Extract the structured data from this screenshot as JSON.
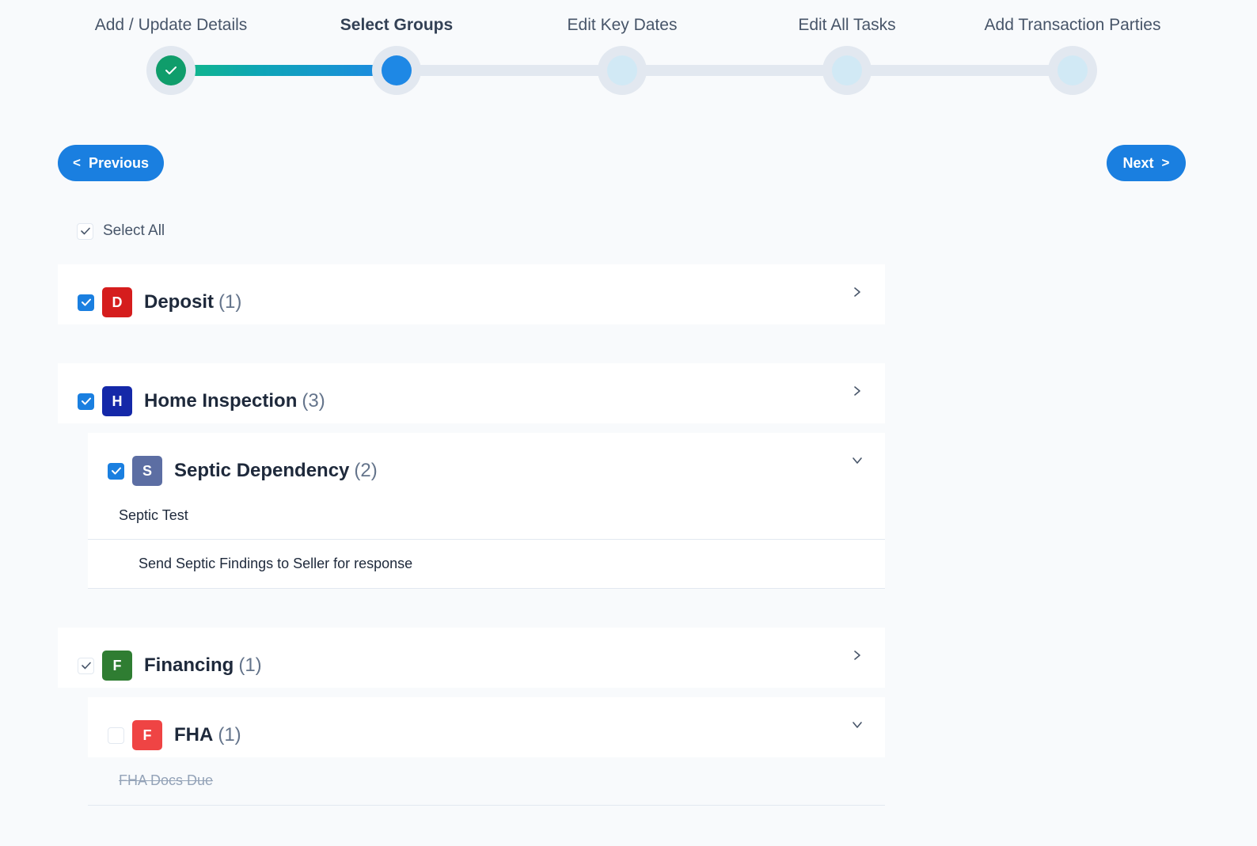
{
  "stepper": {
    "steps": [
      {
        "label": "Add / Update Details",
        "state": "done"
      },
      {
        "label": "Select Groups",
        "state": "current"
      },
      {
        "label": "Edit Key Dates",
        "state": "pending"
      },
      {
        "label": "Edit All Tasks",
        "state": "pending"
      },
      {
        "label": "Add Transaction Parties",
        "state": "pending"
      }
    ]
  },
  "nav": {
    "previous_label": "Previous",
    "next_label": "Next"
  },
  "select_all": {
    "label": "Select All",
    "checked": true
  },
  "groups": {
    "deposit": {
      "letter": "D",
      "name": "Deposit",
      "count": "(1)",
      "color": "#d51d1d",
      "checked": true
    },
    "home_inspection": {
      "letter": "H",
      "name": "Home Inspection",
      "count": "(3)",
      "color": "#1428a8",
      "checked": true
    },
    "septic": {
      "letter": "S",
      "name": "Septic Dependency",
      "count": "(2)",
      "color": "#5c6ea3",
      "checked": true,
      "tasks": [
        "Septic Test",
        "Send Septic Findings to Seller for response"
      ]
    },
    "financing": {
      "letter": "F",
      "name": "Financing",
      "count": "(1)",
      "color": "#2f7d32",
      "checked": true
    },
    "fha": {
      "letter": "F",
      "name": "FHA",
      "count": "(1)",
      "color": "#ef4444",
      "checked": false,
      "tasks": [
        "FHA Docs Due"
      ]
    }
  },
  "colors": {
    "accent": "#1a7fe0",
    "done": "#0f9d6b"
  }
}
